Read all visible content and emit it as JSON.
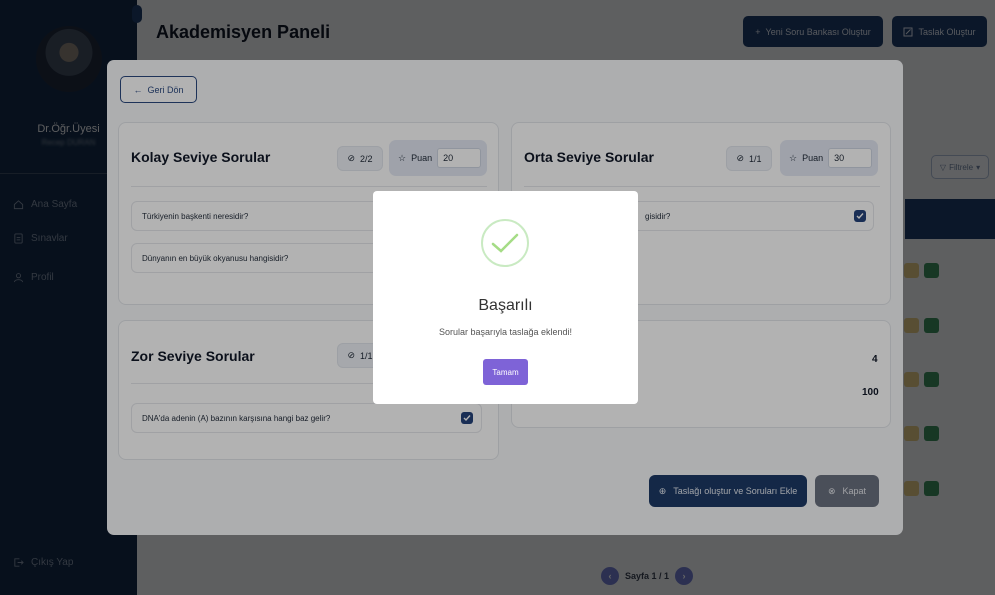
{
  "sidebar": {
    "user_name": "Dr.Öğr.Üyesi",
    "user_subtitle": "Recep DURAN",
    "items": [
      {
        "label": "Ana Sayfa",
        "icon": "home-icon"
      },
      {
        "label": "Sınavlar",
        "icon": "document-icon"
      },
      {
        "label": "Profil",
        "icon": "user-icon"
      }
    ],
    "logout_label": "Çıkış Yap"
  },
  "header": {
    "title": "Akademisyen Paneli",
    "new_bank_label": "Yeni Soru Bankası Oluştur",
    "draft_label": "Taslak Oluştur"
  },
  "background": {
    "filter_label": "Filtrele",
    "pager_label": "Sayfa 1 / 1"
  },
  "modal": {
    "back_label": "Geri Dön",
    "easy": {
      "title": "Kolay Seviye Sorular",
      "count": "2/2",
      "puan_label": "Puan",
      "puan_value": "20",
      "questions": [
        "Türkiyenin başkenti neresidir?",
        "Dünyanın en büyük okyanusu hangisidir?"
      ]
    },
    "medium": {
      "title": "Orta Seviye Sorular",
      "count": "1/1",
      "puan_label": "Puan",
      "puan_value": "30",
      "question_partial": "gisidir?"
    },
    "hard": {
      "title": "Zor Seviye Sorular",
      "count": "1/1",
      "question": "DNA'da adenin (A) bazının karşısına hangi baz gelir?"
    },
    "summary": {
      "total_questions": "4",
      "total_points": "100"
    },
    "create_label": "Taslağı oluştur ve Soruları Ekle",
    "close_label": "Kapat"
  },
  "alert": {
    "title": "Başarılı",
    "message": "Sorular başarıyla taslağa eklendi!",
    "ok_label": "Tamam"
  },
  "colors": {
    "primary": "#1d3a66",
    "sidebar": "#132a47",
    "confirm": "#7e63d7",
    "success": "#a5dc86"
  }
}
